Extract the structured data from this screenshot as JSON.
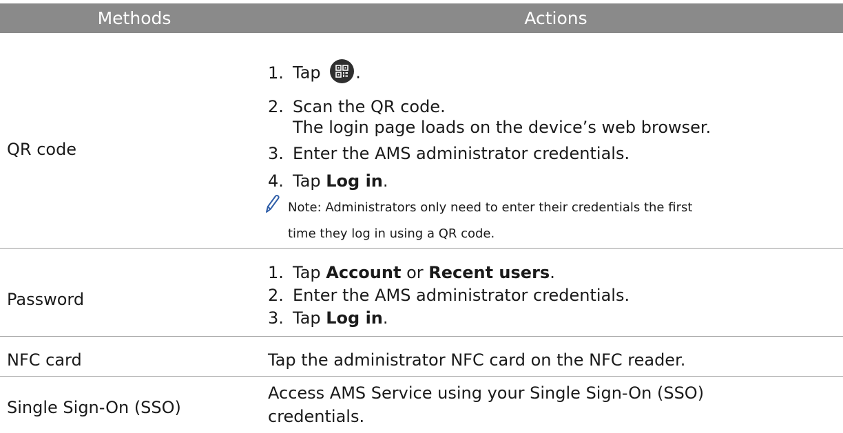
{
  "header": {
    "methods": "Methods",
    "actions": "Actions"
  },
  "rows": {
    "qr": {
      "method": "QR code",
      "steps": [
        {
          "num": "1.",
          "pre": "Tap ",
          "post": "."
        },
        {
          "num": "2.",
          "text": "Scan the QR code."
        },
        {
          "num": "3.",
          "text": "Enter the AMS administrator credentials."
        },
        {
          "num": "4.",
          "pre": "Tap ",
          "bold": "Log in",
          "post": "."
        }
      ],
      "step2_sub": "The login page loads on the device’s web browser.",
      "note_line1": "Note: Administrators only need to enter their credentials the first",
      "note_line2": "time they log in using a QR code."
    },
    "password": {
      "method": "Password",
      "steps": [
        {
          "num": "1.",
          "pre": "Tap ",
          "bold1": "Account",
          "mid": " or ",
          "bold2": "Recent users",
          "post": "."
        },
        {
          "num": "2.",
          "text": "Enter the AMS administrator credentials."
        },
        {
          "num": "3.",
          "pre": "Tap ",
          "bold": "Log in",
          "post": "."
        }
      ]
    },
    "nfc": {
      "method": "NFC card",
      "action": "Tap the administrator NFC card on the NFC reader."
    },
    "sso": {
      "method": "Single Sign-On (SSO)",
      "action_line1": "Access AMS Service using your Single Sign-On (SSO)",
      "action_line2": "credentials."
    }
  },
  "icons": {
    "qr_button": "qr-code-icon",
    "note": "pencil-note-icon"
  },
  "colors": {
    "header_bg": "#8a8a8a",
    "header_text": "#ffffff",
    "note_icon": "#2f5ea8",
    "qr_button_bg": "#2f2f2f"
  }
}
